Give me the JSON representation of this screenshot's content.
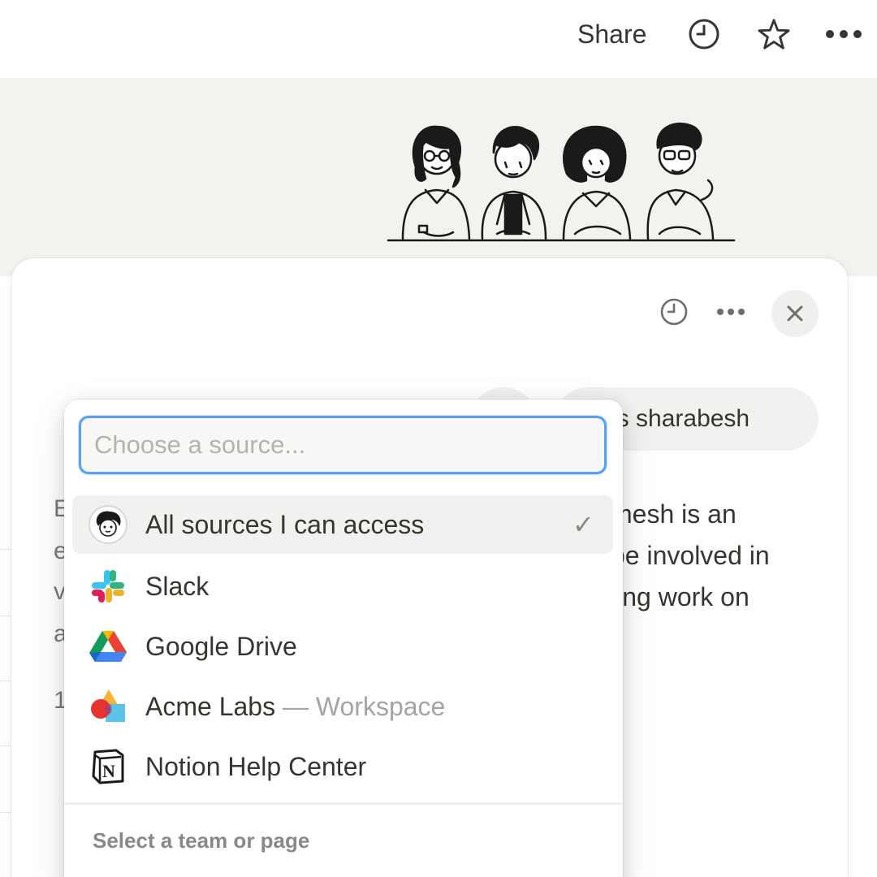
{
  "topbar": {
    "share_label": "Share",
    "icons": [
      "history-icon",
      "star-icon",
      "more-icon"
    ]
  },
  "panel": {
    "icons": [
      "history-icon",
      "more-icon",
      "close-icon"
    ],
    "user_message_visible": "o is sharabesh",
    "answer_lines": [
      "mesh is an",
      "be involved in",
      "ling work on"
    ],
    "left_fragments": [
      "E",
      "e",
      "v",
      "a",
      "1"
    ]
  },
  "source_picker": {
    "search_placeholder": "Choose a source...",
    "items": [
      {
        "label": "All sources I can access",
        "icon": "user-avatar-icon",
        "selected": true
      },
      {
        "label": "Slack",
        "icon": "slack-icon",
        "selected": false
      },
      {
        "label": "Google Drive",
        "icon": "google-drive-icon",
        "selected": false
      },
      {
        "label": "Acme Labs",
        "sublabel": "— Workspace",
        "icon": "acme-labs-icon",
        "selected": false
      },
      {
        "label": "Notion Help Center",
        "icon": "notion-icon",
        "selected": false
      }
    ],
    "section_label": "Select a team or page"
  },
  "colors": {
    "accent_focus": "#5aa0ef",
    "cover_bg": "#f4f2ee",
    "text": "#37352f"
  }
}
